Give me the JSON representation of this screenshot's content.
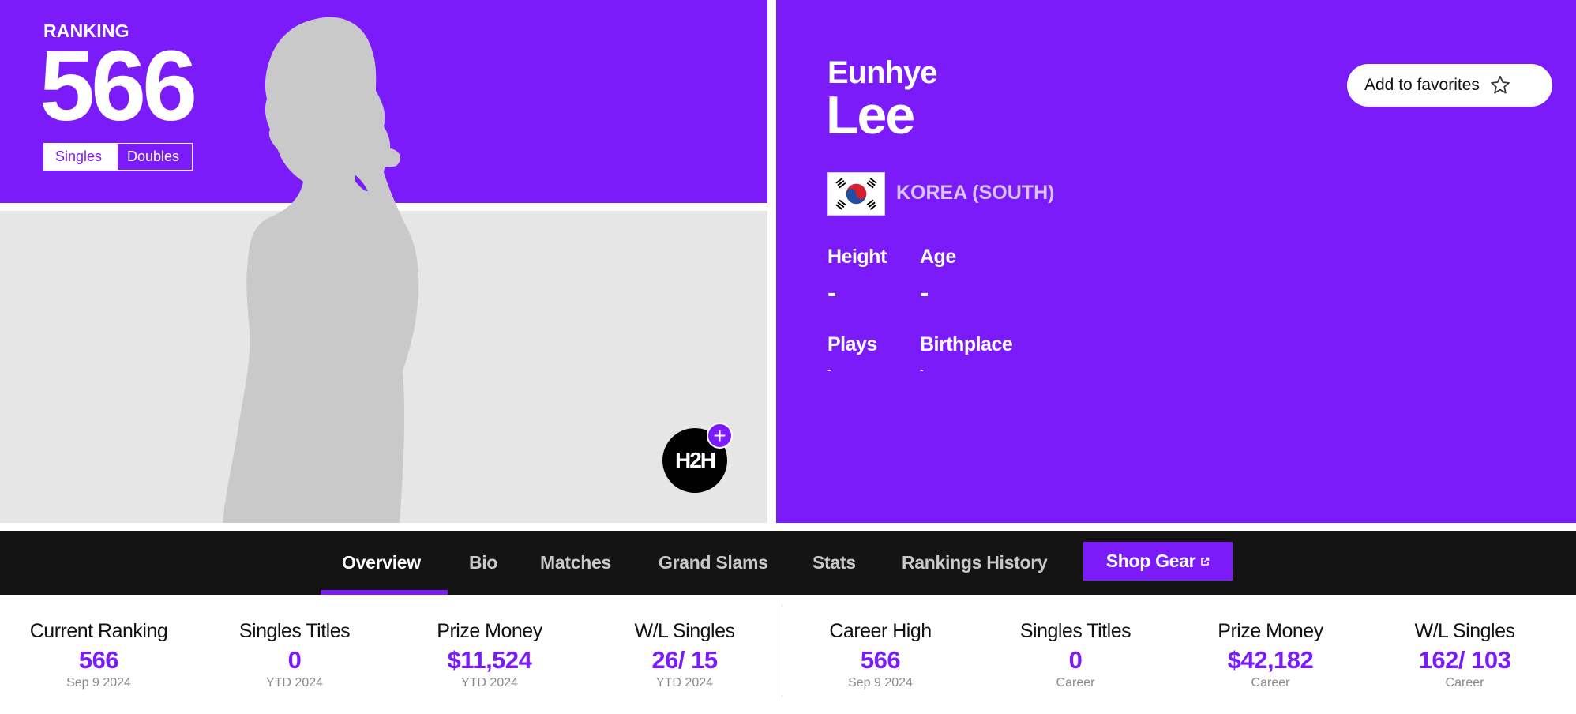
{
  "ranking": {
    "label": "RANKING",
    "value": "566",
    "toggle": {
      "singles": "Singles",
      "doubles": "Doubles",
      "active": "singles"
    }
  },
  "h2h": {
    "label": "H2H",
    "plus": "+"
  },
  "player": {
    "first_name": "Eunhye",
    "last_name": "Lee",
    "country": "KOREA (SOUTH)",
    "flag_icon": "flag-korea-south-icon"
  },
  "favorites": {
    "label": "Add to favorites",
    "icon": "star-outline-icon"
  },
  "info": {
    "height": {
      "label": "Height",
      "value": "-"
    },
    "age": {
      "label": "Age",
      "value": "-"
    },
    "plays": {
      "label": "Plays",
      "value": "-"
    },
    "birthplace": {
      "label": "Birthplace",
      "value": "-"
    }
  },
  "nav": {
    "items": [
      {
        "label": "Overview"
      },
      {
        "label": "Bio"
      },
      {
        "label": "Matches"
      },
      {
        "label": "Grand Slams"
      },
      {
        "label": "Stats"
      },
      {
        "label": "Rankings History"
      }
    ],
    "active": "Overview",
    "shop": {
      "label": "Shop Gear",
      "icon": "external-link-icon"
    }
  },
  "stats": {
    "ytd": [
      {
        "label": "Current Ranking",
        "value": "566",
        "sub": "Sep 9 2024"
      },
      {
        "label": "Singles Titles",
        "value": "0",
        "sub": "YTD 2024"
      },
      {
        "label": "Prize Money",
        "value": "$11,524",
        "sub": "YTD 2024"
      },
      {
        "label": "W/L Singles",
        "value": "26/ 15",
        "sub": "YTD 2024"
      }
    ],
    "career": [
      {
        "label": "Career High",
        "value": "566",
        "sub": "Sep 9 2024"
      },
      {
        "label": "Singles Titles",
        "value": "0",
        "sub": "Career"
      },
      {
        "label": "Prize Money",
        "value": "$42,182",
        "sub": "Career"
      },
      {
        "label": "W/L Singles",
        "value": "162/ 103",
        "sub": "Career"
      }
    ]
  },
  "colors": {
    "brand_purple": "#7c1bfa",
    "nav_bg": "#141414",
    "photo_bg": "#e6e6e6",
    "silhouette": "#c9c9c9"
  }
}
